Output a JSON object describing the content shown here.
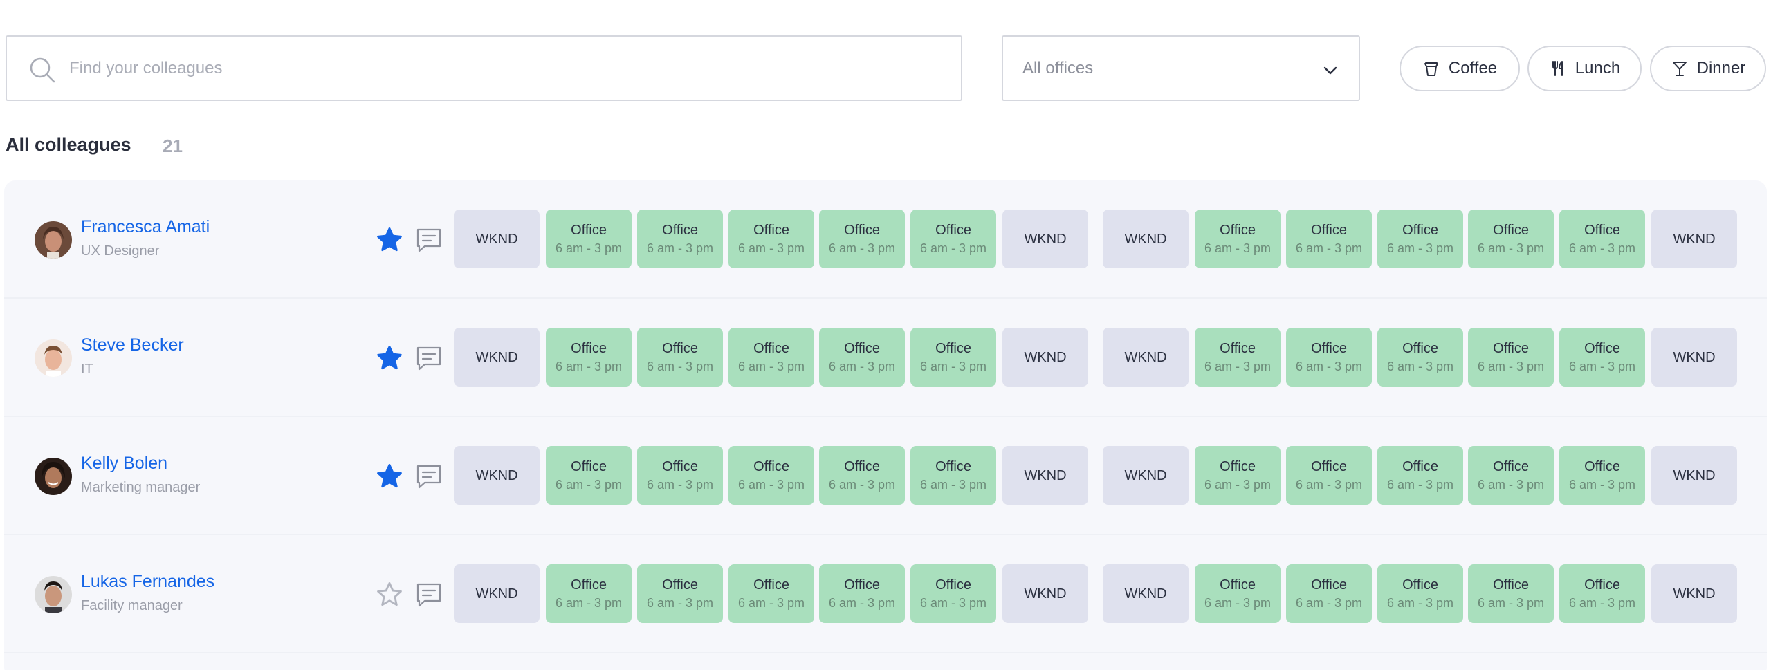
{
  "search": {
    "placeholder": "Find your colleagues",
    "value": ""
  },
  "office_filter": {
    "selected": "All offices"
  },
  "meal_filters": [
    {
      "label": "Coffee",
      "icon": "coffee-cup-icon"
    },
    {
      "label": "Lunch",
      "icon": "fork-knife-icon"
    },
    {
      "label": "Dinner",
      "icon": "cocktail-glass-icon"
    }
  ],
  "list": {
    "title": "All colleagues",
    "count": "21"
  },
  "day_labels": {
    "weekend": "WKND",
    "office": "Office",
    "hours": "6 am - 3 pm"
  },
  "colors": {
    "accent": "#1565e6",
    "office": "#a9dfbd",
    "weekend": "#dfe1ee"
  },
  "colleagues": [
    {
      "name": "Francesca Amati",
      "role": "UX Designer",
      "favorite": true,
      "week1": [
        "WKND",
        "Office",
        "Office",
        "Office",
        "Office",
        "Office",
        "WKND"
      ],
      "week2": [
        "WKND",
        "Office",
        "Office",
        "Office",
        "Office",
        "Office",
        "WKND"
      ]
    },
    {
      "name": "Steve Becker",
      "role": "IT",
      "favorite": true,
      "week1": [
        "WKND",
        "Office",
        "Office",
        "Office",
        "Office",
        "Office",
        "WKND"
      ],
      "week2": [
        "WKND",
        "Office",
        "Office",
        "Office",
        "Office",
        "Office",
        "WKND"
      ]
    },
    {
      "name": "Kelly Bolen",
      "role": "Marketing manager",
      "favorite": true,
      "week1": [
        "WKND",
        "Office",
        "Office",
        "Office",
        "Office",
        "Office",
        "WKND"
      ],
      "week2": [
        "WKND",
        "Office",
        "Office",
        "Office",
        "Office",
        "Office",
        "WKND"
      ]
    },
    {
      "name": "Lukas Fernandes",
      "role": "Facility manager",
      "favorite": false,
      "week1": [
        "WKND",
        "Office",
        "Office",
        "Office",
        "Office",
        "Office",
        "WKND"
      ],
      "week2": [
        "WKND",
        "Office",
        "Office",
        "Office",
        "Office",
        "Office",
        "WKND"
      ]
    }
  ]
}
